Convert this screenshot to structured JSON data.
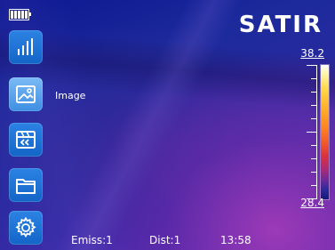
{
  "app": {
    "brand": "SATIR"
  },
  "battery": {
    "icon": "battery-full-icon",
    "bars": 5
  },
  "sidebar": {
    "items": [
      {
        "icon": "bar-chart-icon",
        "active": false
      },
      {
        "icon": "image-icon",
        "active": true,
        "label": "Image"
      },
      {
        "icon": "video-icon",
        "active": false
      },
      {
        "icon": "folder-icon",
        "active": false
      },
      {
        "icon": "gear-icon",
        "active": false
      }
    ]
  },
  "scale": {
    "max": "38.2",
    "min": "28.4"
  },
  "status": {
    "emissivity": "Emiss:1",
    "distance": "Dist:1",
    "time": "13:58"
  },
  "colors": {
    "button": "#1a6fd2",
    "button_active": "#5ea6ef",
    "palette_hot": "#ffd84a",
    "palette_cold": "#141a78"
  }
}
